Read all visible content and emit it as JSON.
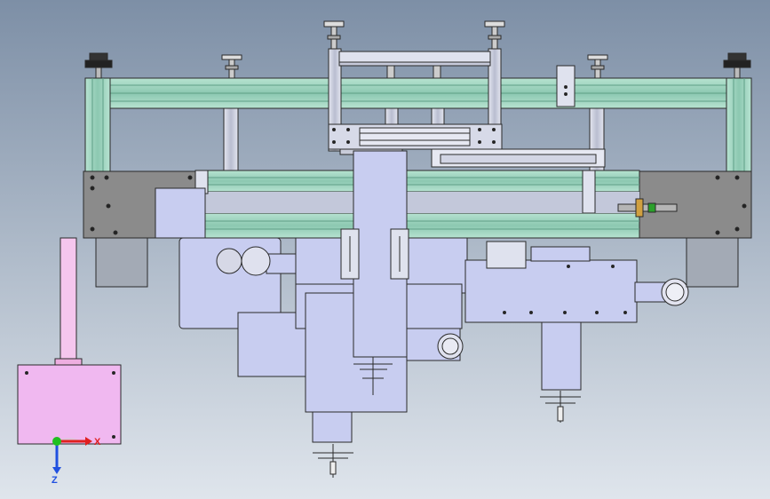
{
  "viewport": {
    "background_top": "#7d8fa6",
    "background_bottom": "#dfe5ec"
  },
  "colors": {
    "extrusion": "#9fd4be",
    "extrusion_dark": "#5e9e86",
    "plate_dark": "#8b8b8b",
    "steel": "#c9ccd9",
    "body": "#c8cdf0",
    "outline": "#2a2a2a",
    "pink": "#f0b8f0",
    "pink_tube": "#f5c6ee",
    "x_axis": "#e02020",
    "y_axis": "#20c020",
    "z_axis": "#2050e0"
  },
  "triad": {
    "x_label": "X",
    "z_label": "Z"
  }
}
